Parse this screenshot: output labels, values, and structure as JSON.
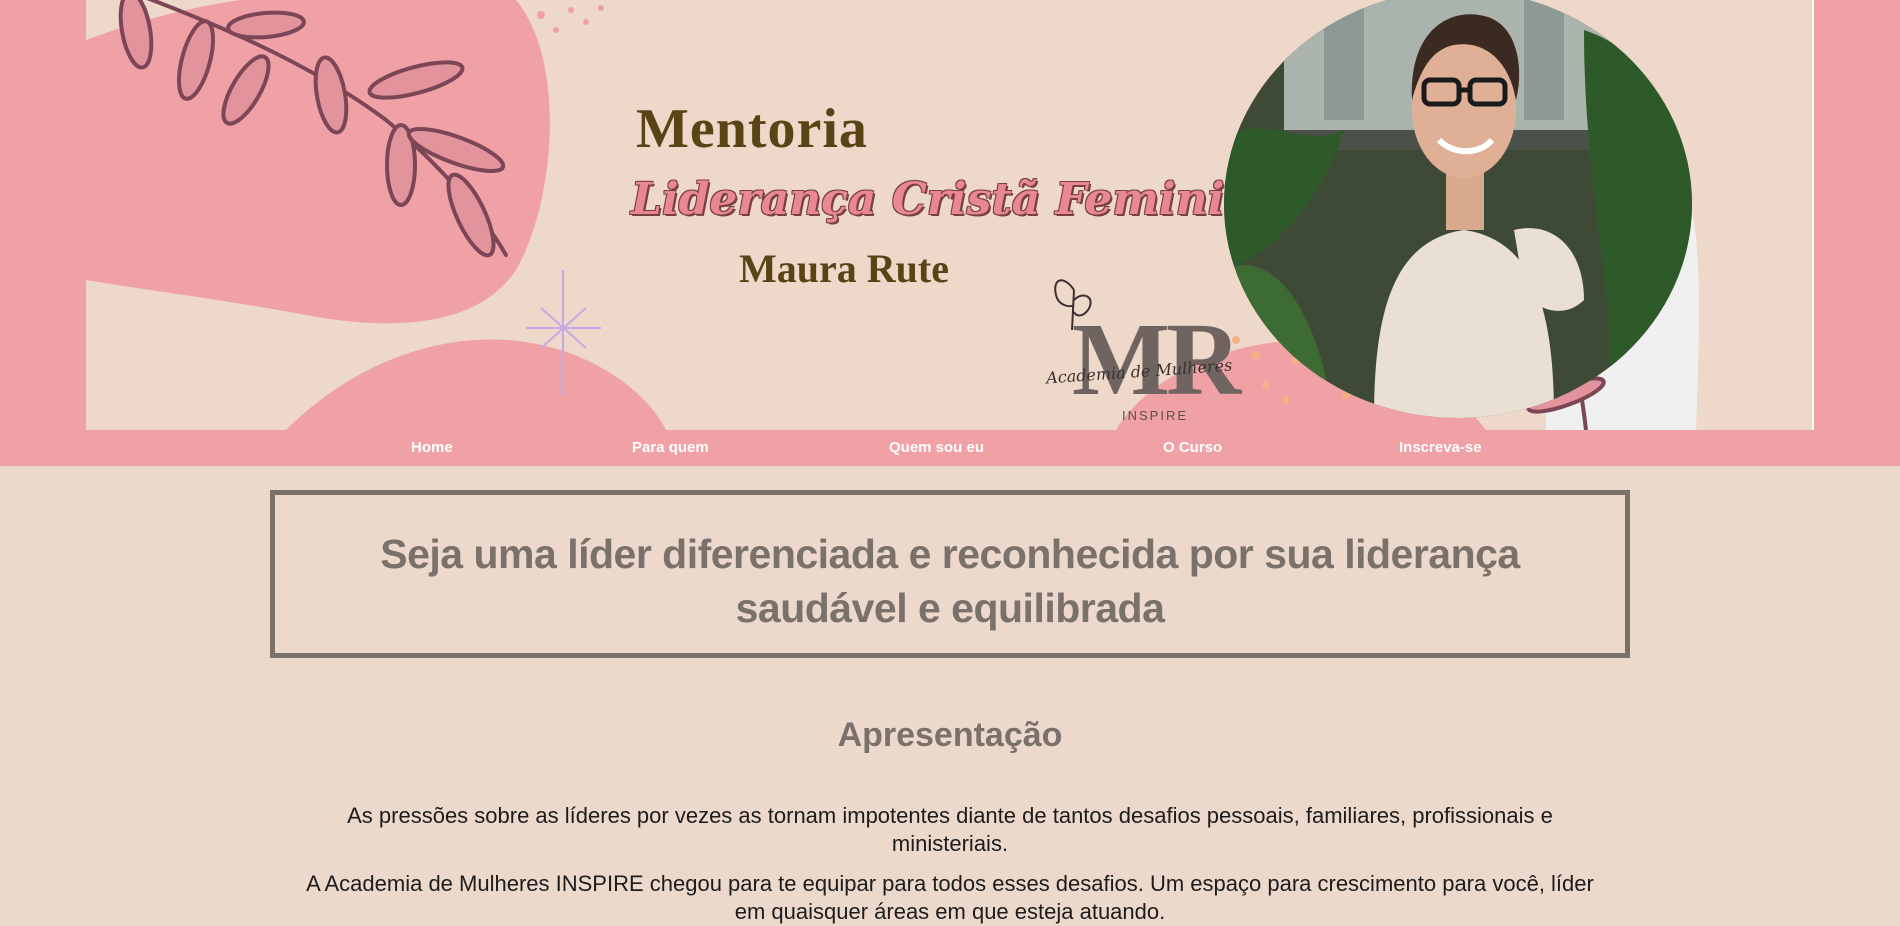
{
  "hero": {
    "title_line1": "Mentoria",
    "title_line2": "Liderança Cristã Feminina",
    "author": "Maura Rute",
    "logo": {
      "letters": "MR",
      "script": "Academia de Mulheres",
      "brand": "INSPIRE"
    },
    "photo_alt": "Maura Rute"
  },
  "nav": {
    "items": [
      {
        "label": "Home"
      },
      {
        "label": "Para quem"
      },
      {
        "label": "Quem sou eu"
      },
      {
        "label": "O Curso"
      },
      {
        "label": "Inscreva-se"
      }
    ]
  },
  "headline": {
    "line1": "Seja uma líder diferenciada e reconhecida por sua liderança",
    "line2": "saudável e equilibrada"
  },
  "presentation": {
    "title": "Apresentação",
    "paragraph1_line1": "As pressões sobre as líderes por vezes as tornam impotentes diante de tantos desafios pessoais, familiares, profissionais e",
    "paragraph1_line2": "ministeriais.",
    "paragraph2_line1": "A Academia de Mulheres INSPIRE chegou para te equipar para todos esses desafios. Um espaço para crescimento para você, líder",
    "paragraph2_line2": "em quaisquer áreas em que esteja atuando."
  },
  "colors": {
    "background": "#edd9cc",
    "pink": "#f0a1a6",
    "banner": "#eed8ca",
    "heading_gray": "#7a716b",
    "title_brown": "#5a4415",
    "leaf": "#7d4656"
  }
}
